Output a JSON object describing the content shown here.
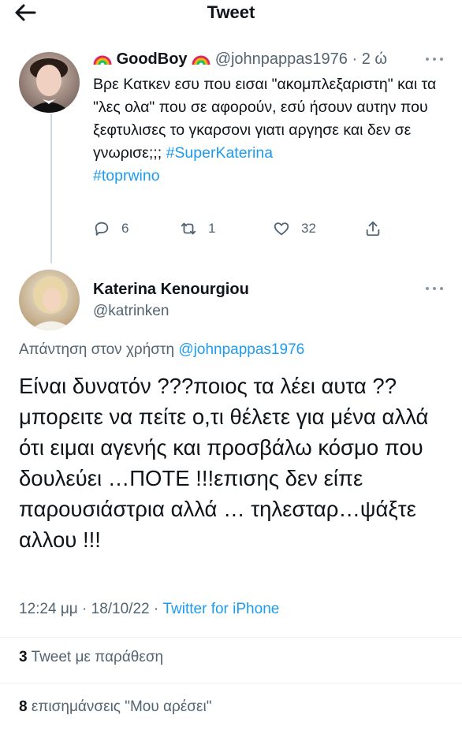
{
  "header": {
    "title": "Tweet"
  },
  "reply_tweet": {
    "display_name": "GoodBoy",
    "handle": "@johnpappas1976",
    "separator": " · ",
    "time": "2 ώ",
    "text_main": "Βρε Κατκεν εσυ που εισαι \"ακομπλεξαριστη\" και τα \"λες ολα\" που σε αφορούν, εσύ ήσουν αυτην που ξεφτυλισες το γκαρσονι γιατι αργησε και δεν σε γνωρισε;;; ",
    "hashtag_1": "#SuperKaterina",
    "hashtag_2": "#toprwino",
    "reply_count": "6",
    "retweet_count": "1",
    "like_count": "32"
  },
  "main_tweet": {
    "display_name": "Katerina Kenourgiou",
    "handle": "@katrinken",
    "replying_prefix": "Απάντηση στον χρήστη ",
    "replying_to": "@johnpappas1976",
    "text": "Είναι δυνατόν ???ποιος τα λέει αυτα ?? μπορειτε να πείτε ο,τι θέλετε για μένα αλλά ότι ειμαι αγενής και προσβάλω κόσμο που δουλεύει …ΠΟΤΕ !!!επισης δεν είπε παρουσιάστρια αλλά … τηλεσταρ…ψάξτε αλλου !!!",
    "time": "12:24 μμ",
    "separator": " · ",
    "date": "18/10/22",
    "source": "Twitter for iPhone",
    "quote_count": "3",
    "quote_label": " Tweet με παράθεση",
    "like_count": "8",
    "like_label": " επισημάνσεις \"Μου αρέσει\""
  },
  "colors": {
    "accent": "#1d9bf0",
    "text": "#0f1419",
    "secondary": "#536471",
    "divider": "#eff3f4"
  },
  "icons": [
    "back-arrow-icon",
    "more-icon",
    "reply-icon",
    "retweet-icon",
    "like-icon",
    "share-icon",
    "rainbow-emoji-icon"
  ]
}
